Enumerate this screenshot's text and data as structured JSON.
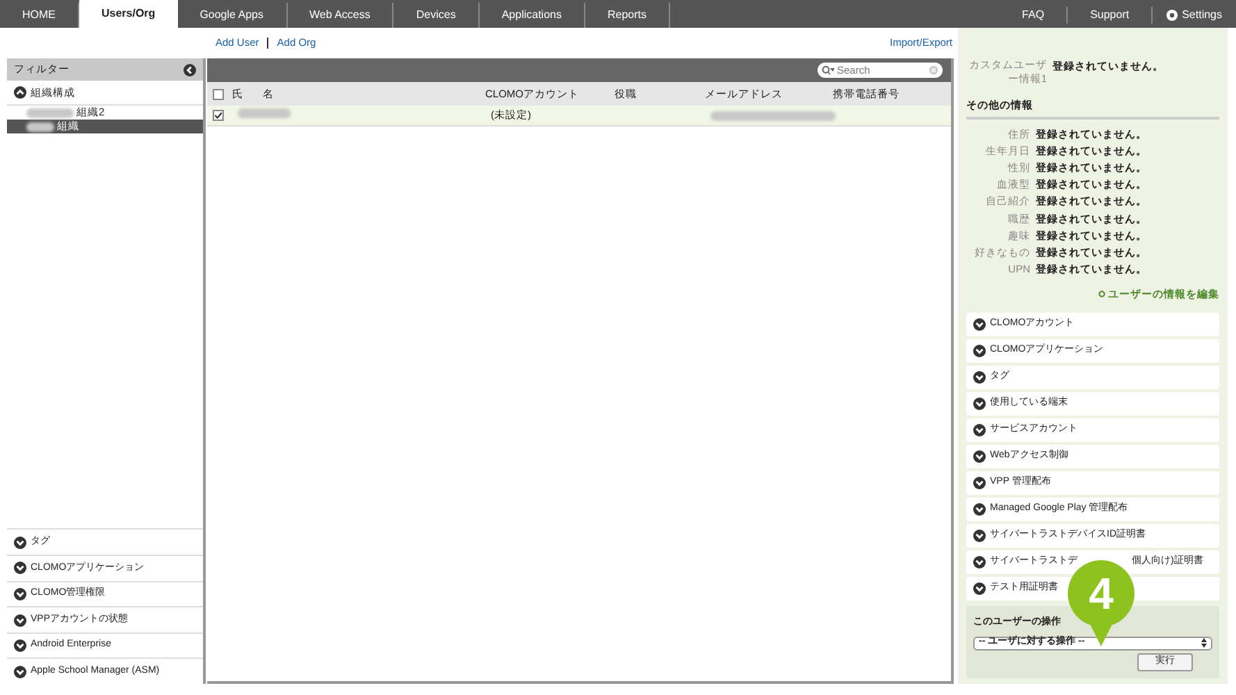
{
  "nav": {
    "tabs": [
      {
        "label": "HOME",
        "selected": false
      },
      {
        "label": "Users/Org",
        "selected": true
      },
      {
        "label": "Google Apps",
        "selected": false
      },
      {
        "label": "Web Access",
        "selected": false
      },
      {
        "label": "Devices",
        "selected": false
      },
      {
        "label": "Applications",
        "selected": false
      },
      {
        "label": "Reports",
        "selected": false
      }
    ],
    "right_links": [
      "FAQ",
      "Support"
    ],
    "settings": "Settings"
  },
  "actions": {
    "left": [
      "Add User",
      "Add Org"
    ],
    "right": "Import/Export"
  },
  "sidebar": {
    "title": "フィルター",
    "tree": {
      "label": "組織構成",
      "expanded": true,
      "children": [
        {
          "label": "組織2",
          "selected": false
        },
        {
          "label": "組織",
          "selected": true
        }
      ]
    },
    "sections": [
      {
        "label": "タグ",
        "expanded": false
      },
      {
        "label": "CLOMOアプリケーション",
        "expanded": false
      },
      {
        "label": "CLOMO管理権限",
        "expanded": false
      },
      {
        "label": "VPPアカウントの状態",
        "expanded": false
      },
      {
        "label": "Android Enterprise",
        "expanded": false
      },
      {
        "label": "Apple School Manager (ASM)",
        "expanded": false
      }
    ]
  },
  "table": {
    "search": {
      "placeholder": "Search"
    },
    "all_checked": false,
    "columns": [
      "氏",
      "名",
      "CLOMOアカウント",
      "役職",
      "メールアドレス",
      "携帯電話番号"
    ],
    "rows": [
      {
        "checked": true,
        "clomo_account": "(未設定)"
      }
    ]
  },
  "details": {
    "custom": {
      "label": "カスタムユーザー情報1",
      "value": "登録されていません。"
    },
    "other_title": "その他の情報",
    "fields": [
      {
        "label": "住所",
        "value": "登録されていません。"
      },
      {
        "label": "生年月日",
        "value": "登録されていません。"
      },
      {
        "label": "性別",
        "value": "登録されていません。"
      },
      {
        "label": "血液型",
        "value": "登録されていません。"
      },
      {
        "label": "自己紹介",
        "value": "登録されていません。"
      },
      {
        "label": "職歴",
        "value": "登録されていません。"
      },
      {
        "label": "趣味",
        "value": "登録されていません。"
      },
      {
        "label": "好きなもの",
        "value": "登録されていません。"
      },
      {
        "label": "UPN",
        "value": "登録されていません。"
      }
    ],
    "edit_link": "ユーザーの情報を編集",
    "sections": [
      {
        "parts": [
          "CLOMOアカウント"
        ]
      },
      {
        "parts": [
          "CLOMOアプリケーション"
        ]
      },
      {
        "parts": [
          "タグ"
        ]
      },
      {
        "parts": [
          "使用している端末"
        ]
      },
      {
        "parts": [
          "サービスアカウント"
        ]
      },
      {
        "parts": [
          "Webアクセス制御"
        ]
      },
      {
        "parts": [
          "VPP 管理配布"
        ]
      },
      {
        "parts": [
          "Managed Google Play 管理配布"
        ]
      },
      {
        "parts": [
          "サイバートラストデバイスID証明書"
        ]
      },
      {
        "parts": [
          "サイバートラストデ",
          "個人向け)証明書"
        ]
      },
      {
        "parts": [
          "テスト用証明書"
        ]
      }
    ],
    "operation": {
      "title": "このユーザーの操作",
      "select": "-- ユーザに対する操作 --",
      "button": "実行"
    }
  },
  "callout": {
    "number": "4"
  }
}
